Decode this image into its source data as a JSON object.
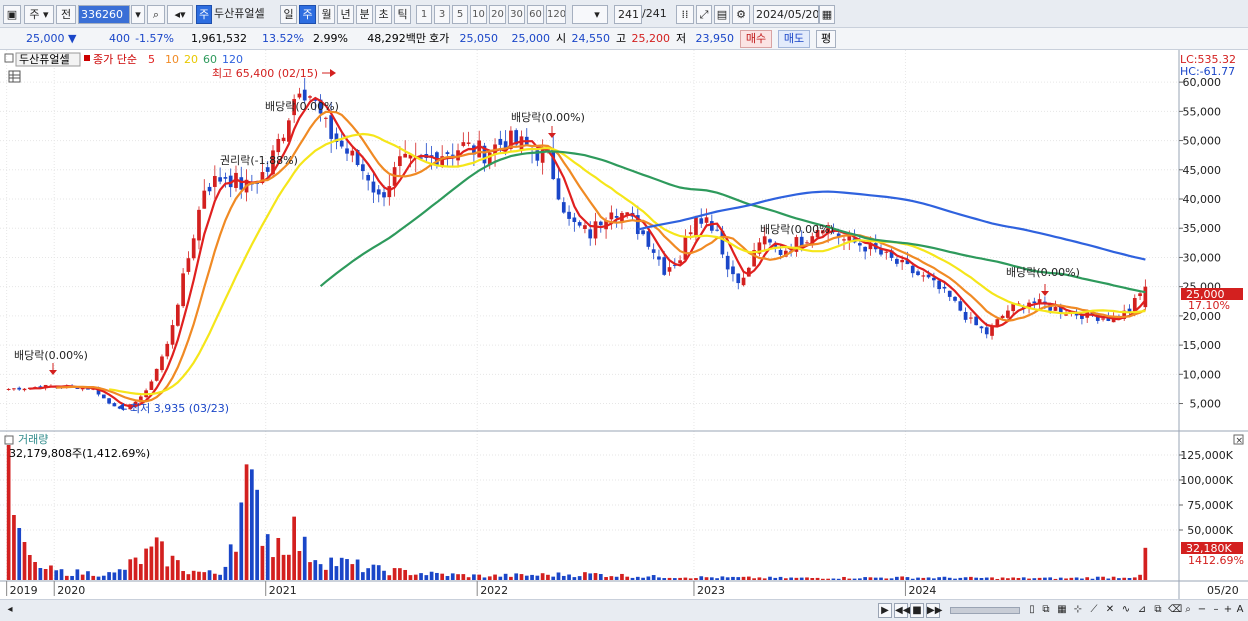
{
  "toolbar": {
    "period_code": "주",
    "prev_label": "전",
    "stock_code": "336260",
    "stock_name": "두산퓨얼셀",
    "period_tabs": [
      "일",
      "주",
      "월",
      "년",
      "분",
      "초",
      "틱"
    ],
    "active_period": "주",
    "intervals": [
      "1",
      "3",
      "5",
      "10",
      "20",
      "30",
      "60",
      "120"
    ],
    "count": "241",
    "count_total": "/241",
    "date": "2024/05/20",
    "sub_label": "주"
  },
  "quote": {
    "price": "25,000",
    "change": "400",
    "change_pct": "-1.57%",
    "volume": "1,961,532",
    "vol_ratio": "13.52%",
    "turnover": "2.99%",
    "amount": "48,292백만",
    "hoga_label": "호가",
    "ask": "25,050",
    "bid": "25,000",
    "open_label": "시",
    "open": "24,550",
    "high_label": "고",
    "high": "25,200",
    "low_label": "저",
    "low": "23,950",
    "buy_label": "매수",
    "sell_label": "매도",
    "eval_label": "평"
  },
  "legend": {
    "name": "두산퓨얼셀",
    "type": "종가 단순",
    "ma": [
      {
        "label": "5",
        "color": "#e0201f"
      },
      {
        "label": "10",
        "color": "#f08a24"
      },
      {
        "label": "20",
        "color": "#f5e61a"
      },
      {
        "label": "60",
        "color": "#2e9a5c"
      },
      {
        "label": "120",
        "color": "#2f62de"
      }
    ]
  },
  "right_info": {
    "lc": "LC:535.32",
    "hc": "HC:-61.77"
  },
  "volume_panel": {
    "title": "거래량",
    "value": "32,179,808주(1,412.69%)",
    "last_label": "32,180K",
    "last_pct": "1412.69%"
  },
  "colors": {
    "up": "#d3201f",
    "down": "#1a46c8",
    "accent": "#2d6de0"
  },
  "chart_data": {
    "type": "candlestick",
    "period": "weekly",
    "x_range": [
      "2019-11",
      "2024-05-20"
    ],
    "x_ticks": [
      "2019",
      "2020",
      "2021",
      "2022",
      "2023",
      "2024",
      "05/20"
    ],
    "y_ticks": [
      5000,
      10000,
      15000,
      20000,
      25000,
      30000,
      35000,
      40000,
      45000,
      50000,
      55000,
      60000
    ],
    "y_tick_labels": [
      "5,000",
      "10,000",
      "15,000",
      "20,000",
      "25,000",
      "30,000",
      "35,000",
      "40,000",
      "45,000",
      "50,000",
      "55,000",
      "60,000"
    ],
    "ylim": [
      300,
      65500
    ],
    "last_price_label": "25,000",
    "last_change_label": "17.10%",
    "moving_averages": [
      "5",
      "10",
      "20",
      "60",
      "120"
    ],
    "annotations": [
      {
        "text": "최고 65,400 (02/15)",
        "type": "high",
        "value": 65400
      },
      {
        "text": "최저 3,935 (03/23)",
        "type": "low",
        "value": 3935
      },
      {
        "text": "배당락(0.00%)",
        "type": "event",
        "date": "2020-01"
      },
      {
        "text": "권리락(-1.88%)",
        "type": "event",
        "date": "2020-11"
      },
      {
        "text": "배당락(0.00%)",
        "type": "event",
        "date": "2021-01"
      },
      {
        "text": "배당락(0.00%)",
        "type": "event",
        "date": "2022-01"
      },
      {
        "text": "배당락(0.00%)",
        "type": "event",
        "date": "2022-12"
      },
      {
        "text": "배당락(0.00%)",
        "type": "event",
        "date": "2023-12"
      }
    ],
    "close_keypoints": [
      [
        0,
        7500
      ],
      [
        8,
        8000
      ],
      [
        16,
        7600
      ],
      [
        19,
        5000
      ],
      [
        22,
        3935
      ],
      [
        26,
        7000
      ],
      [
        30,
        15000
      ],
      [
        34,
        30000
      ],
      [
        37,
        42000
      ],
      [
        41,
        44000
      ],
      [
        45,
        42000
      ],
      [
        49,
        45000
      ],
      [
        52,
        52000
      ],
      [
        55,
        60000
      ],
      [
        57,
        58000
      ],
      [
        60,
        52000
      ],
      [
        64,
        48000
      ],
      [
        68,
        44000
      ],
      [
        70,
        40000
      ],
      [
        74,
        46000
      ],
      [
        78,
        46000
      ],
      [
        82,
        48000
      ],
      [
        86,
        49000
      ],
      [
        90,
        48000
      ],
      [
        94,
        50000
      ],
      [
        98,
        49000
      ],
      [
        102,
        47000
      ],
      [
        106,
        36000
      ],
      [
        110,
        34000
      ],
      [
        114,
        39000
      ],
      [
        118,
        36000
      ],
      [
        121,
        33000
      ],
      [
        124,
        28000
      ],
      [
        127,
        30000
      ],
      [
        130,
        38000
      ],
      [
        134,
        35000
      ],
      [
        136,
        28000
      ],
      [
        139,
        26000
      ],
      [
        142,
        33000
      ],
      [
        146,
        31000
      ],
      [
        150,
        33000
      ],
      [
        154,
        36000
      ],
      [
        158,
        33000
      ],
      [
        162,
        32000
      ],
      [
        166,
        30000
      ],
      [
        170,
        28000
      ],
      [
        174,
        26000
      ],
      [
        178,
        23000
      ],
      [
        182,
        19000
      ],
      [
        185,
        17000
      ],
      [
        189,
        21000
      ],
      [
        193,
        22500
      ],
      [
        197,
        21500
      ],
      [
        201,
        20500
      ],
      [
        205,
        20000
      ],
      [
        209,
        19500
      ],
      [
        212,
        21000
      ],
      [
        215,
        25000
      ]
    ],
    "volume_ylim": [
      0,
      140000
    ],
    "volume_ticks": [
      50000,
      75000,
      100000,
      125000
    ],
    "volume_tick_labels": [
      "50,000K",
      "75,000K",
      "100,000K",
      "125,000K"
    ],
    "volume_unit": "K",
    "volume_keypoints": [
      [
        0,
        135000
      ],
      [
        1,
        65000
      ],
      [
        2,
        52000
      ],
      [
        3,
        38000
      ],
      [
        4,
        25000
      ],
      [
        5,
        18000
      ],
      [
        6,
        12000
      ],
      [
        10,
        8000
      ],
      [
        20,
        6000
      ],
      [
        28,
        30000
      ],
      [
        34,
        9000
      ],
      [
        40,
        6000
      ],
      [
        45,
        88000
      ],
      [
        48,
        60000
      ],
      [
        50,
        35000
      ],
      [
        54,
        48000
      ],
      [
        56,
        30000
      ],
      [
        60,
        20000
      ],
      [
        66,
        14000
      ],
      [
        70,
        10000
      ],
      [
        80,
        6000
      ],
      [
        90,
        4000
      ],
      [
        100,
        5000
      ],
      [
        110,
        6000
      ],
      [
        120,
        3500
      ],
      [
        135,
        2500
      ],
      [
        150,
        2000
      ],
      [
        170,
        2500
      ],
      [
        186,
        2000
      ],
      [
        200,
        1800
      ],
      [
        214,
        3500
      ],
      [
        215,
        32180
      ]
    ]
  }
}
